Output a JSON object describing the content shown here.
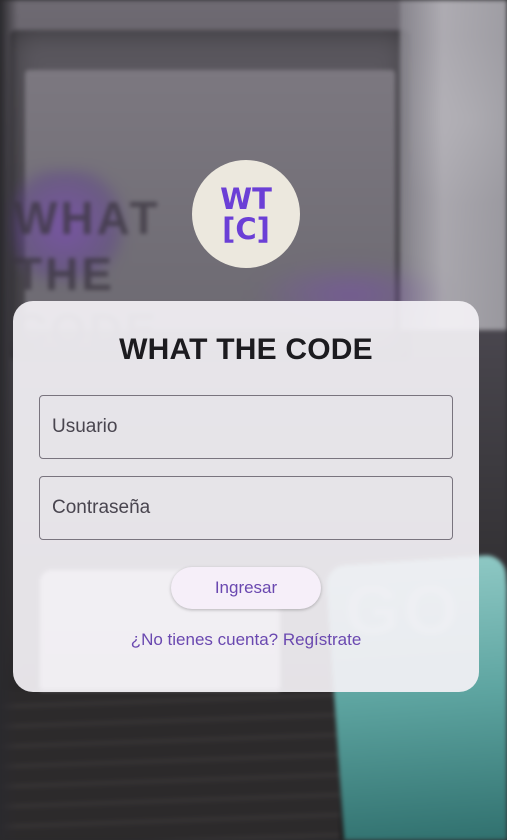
{
  "logo": {
    "line1": "WT",
    "line2": "[C]",
    "color": "#6b3fd6",
    "background": "#ece8de"
  },
  "card": {
    "title": "WHAT THE CODE"
  },
  "form": {
    "username_placeholder": "Usuario",
    "password_placeholder": "Contraseña",
    "login_button": "Ingresar",
    "register_link": "¿No tienes cuenta? Regístrate"
  },
  "background": {
    "board_text": "WHAT\nTHE\nCODE",
    "cup_text": "GO"
  },
  "colors": {
    "accent": "#6a48b0",
    "title": "#1c1b1f",
    "card": "#f3f1f5"
  }
}
